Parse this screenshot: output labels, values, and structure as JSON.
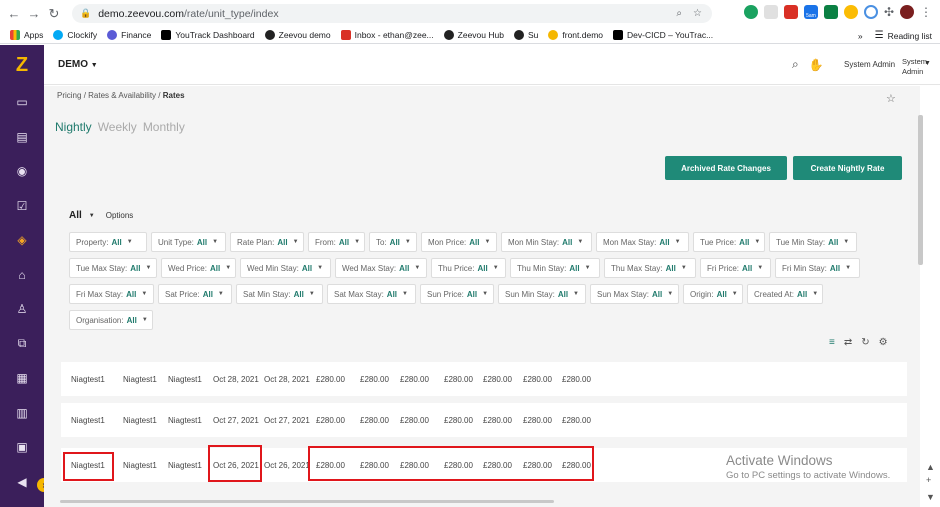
{
  "browser": {
    "url_host": "demo.zeevou.com",
    "url_path": "/rate/unit_type/index",
    "bookmarks": [
      "Apps",
      "Clockify",
      "Finance",
      "YouTrack Dashboard",
      "Zeevou demo",
      "Inbox - ethan@zee...",
      "Zeevou Hub",
      "Su",
      "front.demo",
      "Dev-CICD – YouTrac..."
    ],
    "reading_list": "Reading list",
    "ext_badge": "5am",
    "more": "»"
  },
  "header": {
    "brand": "DEMO",
    "user": "System Admin",
    "avatar_alt": "System Admin"
  },
  "breadcrumb": {
    "items": [
      "Pricing",
      "Rates & Availability"
    ],
    "current": "Rates",
    "sep": "/"
  },
  "tabs": [
    "Nightly",
    "Weekly",
    "Monthly"
  ],
  "buttons": {
    "archived": "Archived Rate Changes",
    "create": "Create Nightly Rate"
  },
  "filter_bar": {
    "all": "All",
    "options": "Options"
  },
  "filters": [
    {
      "label": "Property:",
      "value": "All"
    },
    {
      "label": "Unit Type:",
      "value": "All"
    },
    {
      "label": "Rate Plan:",
      "value": "All"
    },
    {
      "label": "From:",
      "value": "All"
    },
    {
      "label": "To:",
      "value": "All"
    },
    {
      "label": "Mon Price:",
      "value": "All"
    },
    {
      "label": "Mon Min Stay:",
      "value": "All"
    },
    {
      "label": "Mon Max Stay:",
      "value": "All"
    },
    {
      "label": "Tue Price:",
      "value": "All"
    },
    {
      "label": "Tue Min Stay:",
      "value": "All"
    },
    {
      "label": "Tue Max Stay:",
      "value": "All"
    },
    {
      "label": "Wed Price:",
      "value": "All"
    },
    {
      "label": "Wed Min Stay:",
      "value": "All"
    },
    {
      "label": "Wed Max Stay:",
      "value": "All"
    },
    {
      "label": "Thu Price:",
      "value": "All"
    },
    {
      "label": "Thu Min Stay:",
      "value": "All"
    },
    {
      "label": "Thu Max Stay:",
      "value": "All"
    },
    {
      "label": "Fri Price:",
      "value": "All"
    },
    {
      "label": "Fri Min Stay:",
      "value": "All"
    },
    {
      "label": "Fri Max Stay:",
      "value": "All"
    },
    {
      "label": "Sat Price:",
      "value": "All"
    },
    {
      "label": "Sat Min Stay:",
      "value": "All"
    },
    {
      "label": "Sat Max Stay:",
      "value": "All"
    },
    {
      "label": "Sun Price:",
      "value": "All"
    },
    {
      "label": "Sun Min Stay:",
      "value": "All"
    },
    {
      "label": "Sun Max Stay:",
      "value": "All"
    },
    {
      "label": "Origin:",
      "value": "All"
    },
    {
      "label": "Created At:",
      "value": "All"
    },
    {
      "label": "Organisation:",
      "value": "All"
    }
  ],
  "rows": [
    [
      "Niagtest1",
      "Niagtest1",
      "Niagtest1",
      "Oct 28, 2021",
      "Oct 28, 2021",
      "£280.00",
      "£280.00",
      "£280.00",
      "£280.00",
      "£280.00",
      "£280.00",
      "£280.00"
    ],
    [
      "Niagtest1",
      "Niagtest1",
      "Niagtest1",
      "Oct 27, 2021",
      "Oct 27, 2021",
      "£280.00",
      "£280.00",
      "£280.00",
      "£280.00",
      "£280.00",
      "£280.00",
      "£280.00"
    ],
    [
      "Niagtest1",
      "Niagtest1",
      "Niagtest1",
      "Oct 26, 2021",
      "Oct 26, 2021",
      "£280.00",
      "£280.00",
      "£280.00",
      "£280.00",
      "£280.00",
      "£280.00",
      "£280.00"
    ]
  ],
  "watermark": {
    "title": "Activate Windows",
    "subtitle": "Go to PC settings to activate Windows."
  },
  "colors": {
    "sidebar": "#3b1f5b",
    "accent": "#1f8a78",
    "highlight": "#e0161b",
    "logo": "#f5b700"
  }
}
